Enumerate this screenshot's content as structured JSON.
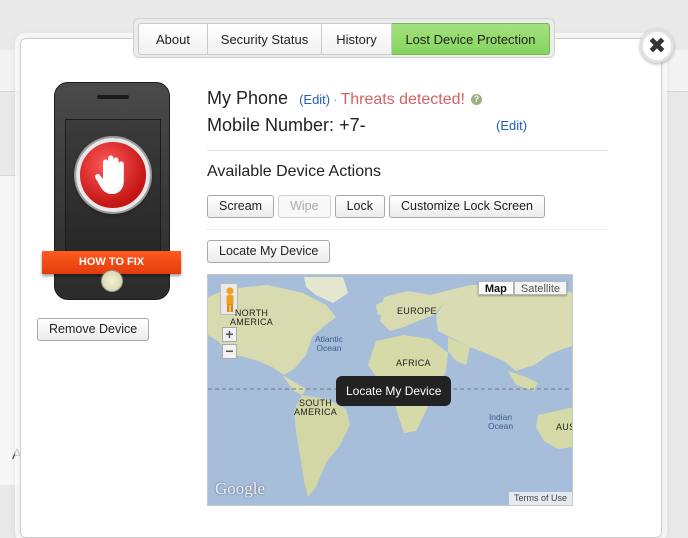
{
  "background": {
    "partial_letter": "A"
  },
  "tabs": [
    {
      "label": "About"
    },
    {
      "label": "Security Status"
    },
    {
      "label": "History"
    },
    {
      "label": "Lost Device Protection"
    }
  ],
  "active_tab": "Lost Device Protection",
  "close_glyph": "✖",
  "phone_panel": {
    "how_to_fix": "HOW TO FIX",
    "remove_device": "Remove Device",
    "icon": "stop-hand-icon"
  },
  "device": {
    "name": "My Phone",
    "edit_label": "(Edit)",
    "separator": "·",
    "status": "Threats detected!",
    "help_glyph": "?",
    "mobile_label": "Mobile Number:",
    "mobile_value": "+7-",
    "mobile_edit_label": "(Edit)"
  },
  "actions": {
    "title": "Available Device Actions",
    "buttons": [
      {
        "label": "Scream",
        "enabled": true
      },
      {
        "label": "Wipe",
        "enabled": false
      },
      {
        "label": "Lock",
        "enabled": true
      },
      {
        "label": "Customize Lock Screen",
        "enabled": true
      }
    ],
    "locate_label": "Locate My Device"
  },
  "map": {
    "type_options": [
      "Map",
      "Satellite"
    ],
    "selected_type": "Map",
    "zoom_in": "+",
    "zoom_out": "−",
    "labels": {
      "north_america": "NORTH\nAMERICA",
      "europe": "EUROPE",
      "africa": "AFRICA",
      "south_america": "SOUTH\nAMERICA",
      "aus": "AUS",
      "atlantic": "Atlantic\nOcean",
      "indian": "Indian\nOcean"
    },
    "tooltip": "Locate My Device",
    "logo": "Google",
    "terms": "Terms of Use"
  },
  "colors": {
    "active_tab": "#8dd867",
    "threat": "#d46262",
    "link": "#1f5fb4",
    "how_to_fix": "#f0501a",
    "ocean": "#a7bedb",
    "land": "#d9dcb4"
  }
}
